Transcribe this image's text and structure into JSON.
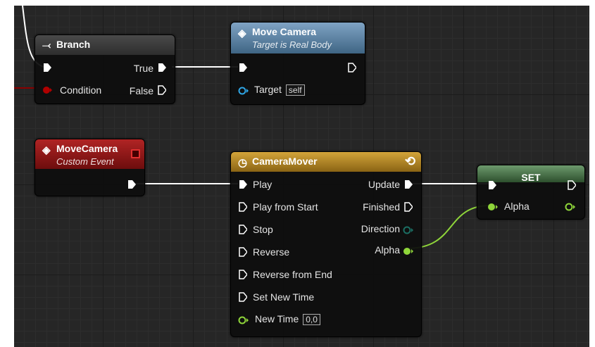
{
  "nodes": {
    "branch": {
      "title": "Branch",
      "pins": {
        "true": "True",
        "condition": "Condition",
        "false": "False"
      }
    },
    "move_camera_call": {
      "title": "Move Camera",
      "subtitle": "Target is Real Body",
      "target_label": "Target",
      "target_value": "self"
    },
    "custom_event": {
      "title": "MoveCamera",
      "subtitle": "Custom Event"
    },
    "timeline": {
      "title": "CameraMover",
      "inputs": {
        "play": "Play",
        "play_from_start": "Play from Start",
        "stop": "Stop",
        "reverse": "Reverse",
        "reverse_from_end": "Reverse from End",
        "set_new_time": "Set New Time",
        "new_time": "New Time"
      },
      "new_time_value": "0,0",
      "outputs": {
        "update": "Update",
        "finished": "Finished",
        "direction": "Direction",
        "alpha": "Alpha"
      }
    },
    "set": {
      "title": "SET",
      "alpha_label": "Alpha"
    }
  },
  "colors": {
    "branch_header": "#3a3a3a",
    "function_header": "#5a7fa0",
    "event_header": "#9a1c1c",
    "timeline_header": "#b88a1e",
    "set_header": "#4d7a4d",
    "exec_wire": "#ffffff",
    "float_wire": "#8fd63a",
    "object_pin": "#2fa6e6",
    "bool_pin": "#a00000"
  }
}
